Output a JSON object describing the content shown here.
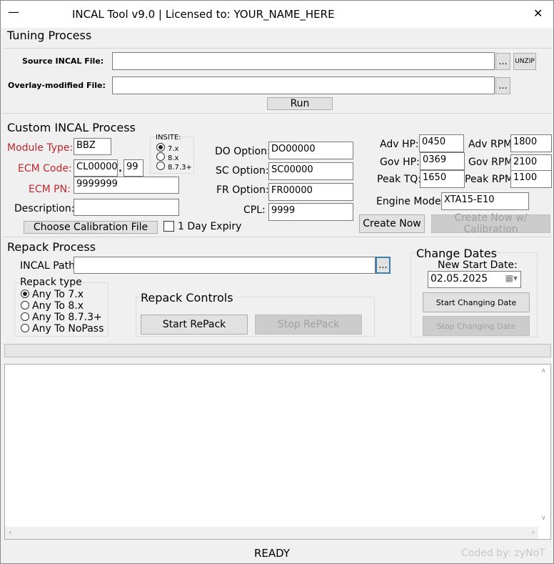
{
  "window": {
    "title": "INCAL Tool v9.0 | Licensed to: YOUR_NAME_HERE",
    "minimize": "—",
    "close": "✕"
  },
  "tuning": {
    "title": "Tuning Process",
    "source_label": "Source INCAL File:",
    "source_value": "",
    "overlay_label": "Overlay-modified File:",
    "overlay_value": "",
    "browse": "...",
    "unzip": "UNZIP",
    "run": "Run"
  },
  "custom": {
    "title": "Custom INCAL Process",
    "module_label": "Module Type:",
    "module_value": "BBZ",
    "ecm_code_label": "ECM Code:",
    "ecm_code_value": "CL00000",
    "ecm_code_sep": ".",
    "ecm_code_suffix": "99",
    "ecm_pn_label": "ECM PN:",
    "ecm_pn_value": "9999999",
    "desc_label": "Description:",
    "desc_value": "",
    "insite_label": "INSITE:",
    "insite_options": [
      "7.x",
      "8.x",
      "8.7.3+"
    ],
    "do_label": "DO Option:",
    "do_value": "DO00000",
    "sc_label": "SC Option:",
    "sc_value": "SC00000",
    "fr_label": "FR Option:",
    "fr_value": "FR00000",
    "cpl_label": "CPL:",
    "cpl_value": "9999",
    "adv_hp_label": "Adv HP:",
    "adv_hp": "0450",
    "gov_hp_label": "Gov HP:",
    "gov_hp": "0369",
    "peak_tq_label": "Peak TQ:",
    "peak_tq": "1650",
    "adv_rpm_label": "Adv RPM:",
    "adv_rpm": "1800",
    "gov_rpm_label": "Gov RPM:",
    "gov_rpm": "2100",
    "peak_rpm_label": "Peak RPM:",
    "peak_rpm": "1100",
    "engine_label": "Engine Model:",
    "engine_value": "XTA15-E10",
    "choose_cal": "Choose Calibration File",
    "expiry": "1 Day Expiry",
    "create_now": "Create Now",
    "create_cal": "Create Now w/ Calibration"
  },
  "repack": {
    "title": "Repack Process",
    "path_label": "INCAL Path:",
    "path_value": "",
    "browse": "...",
    "type_label": "Repack type",
    "types": [
      "Any To 7.x",
      "Any To 8.x",
      "Any To 8.7.3+",
      "Any To NoPass"
    ],
    "controls_label": "Repack Controls",
    "start": "Start RePack",
    "stop": "Stop RePack"
  },
  "dates": {
    "title": "Change Dates",
    "new_start_label": "New Start Date:",
    "date_value": "02.05.2025",
    "start": "Start Changing Date",
    "stop": "Stop Changing Date"
  },
  "status": {
    "text": "READY",
    "credit": "Coded by: zyNoT"
  }
}
